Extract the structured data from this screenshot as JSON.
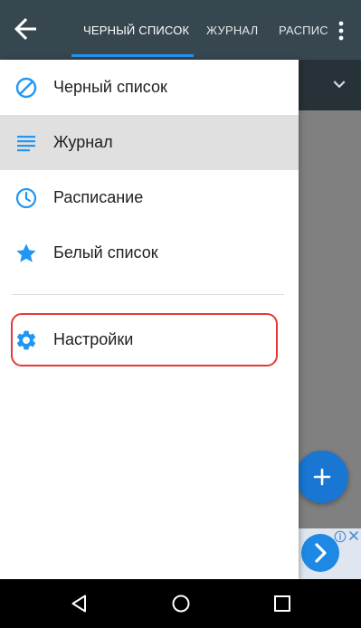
{
  "appbar": {
    "back_icon": "arrow-left-icon",
    "tabs": [
      {
        "label": "ЧЕРНЫЙ СПИСОК",
        "active": true
      },
      {
        "label": "ЖУРНАЛ",
        "active": false
      },
      {
        "label": "РАСПИС",
        "active": false
      }
    ],
    "overflow_icon": "more-vert-icon"
  },
  "drawer": {
    "items": [
      {
        "label": "Черный список",
        "icon": "block-icon",
        "selected": false
      },
      {
        "label": "Журнал",
        "icon": "list-icon",
        "selected": true
      },
      {
        "label": "Расписание",
        "icon": "clock-icon",
        "selected": false
      },
      {
        "label": "Белый список",
        "icon": "star-icon",
        "selected": false
      },
      {
        "label": "Настройки",
        "icon": "gear-icon",
        "selected": false,
        "highlighted": true
      }
    ]
  },
  "fab": {
    "label": "+",
    "icon": "plus-icon"
  },
  "ad": {
    "icon": "chevron-right-icon"
  },
  "system_nav": {
    "buttons": [
      "back-icon",
      "home-icon",
      "recents-icon"
    ]
  },
  "colors": {
    "appbar": "#37474f",
    "accent": "#2196f3",
    "selected_bg": "#e0e0e0",
    "highlight_ring": "#e53935",
    "fab": "#1976d2"
  }
}
